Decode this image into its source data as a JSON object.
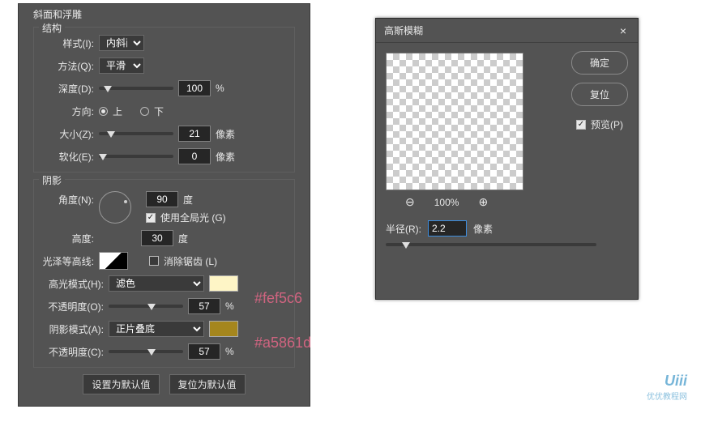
{
  "bevel": {
    "title": "斜面和浮雕",
    "structure": {
      "legend": "结构",
      "style_label": "样式(I):",
      "style_value": "内斜面",
      "technique_label": "方法(Q):",
      "technique_value": "平滑",
      "depth_label": "深度(D):",
      "depth_value": "100",
      "depth_unit": "%",
      "direction_label": "方向:",
      "direction_up": "上",
      "direction_down": "下",
      "size_label": "大小(Z):",
      "size_value": "21",
      "size_unit": "像素",
      "soften_label": "软化(E):",
      "soften_value": "0",
      "soften_unit": "像素"
    },
    "shading": {
      "legend": "阴影",
      "angle_label": "角度(N):",
      "angle_value": "90",
      "angle_unit": "度",
      "global_light_label": "使用全局光 (G)",
      "altitude_label": "高度:",
      "altitude_value": "30",
      "altitude_unit": "度",
      "gloss_label": "光泽等高线:",
      "antialias_label": "消除锯齿 (L)",
      "highlight_mode_label": "高光模式(H):",
      "highlight_mode_value": "滤色",
      "highlight_opacity_label": "不透明度(O):",
      "highlight_opacity_value": "57",
      "highlight_opacity_unit": "%",
      "shadow_mode_label": "阴影模式(A):",
      "shadow_mode_value": "正片叠底",
      "shadow_opacity_label": "不透明度(C):",
      "shadow_opacity_value": "57",
      "shadow_opacity_unit": "%",
      "highlight_color": "#fef5c6",
      "shadow_color": "#a5861d"
    },
    "footer": {
      "default_btn": "设置为默认值",
      "reset_btn": "复位为默认值"
    }
  },
  "gauss": {
    "title": "高斯模糊",
    "ok": "确定",
    "cancel": "复位",
    "preview_label": "预览(P)",
    "zoom": "100%",
    "radius_label": "半径(R):",
    "radius_value": "2.2",
    "radius_unit": "像素"
  },
  "annotations": {
    "highlight": "#fef5c6",
    "shadow": "#a5861d"
  },
  "watermark": {
    "logo": "Uiii",
    "sub": "优优教程网"
  }
}
